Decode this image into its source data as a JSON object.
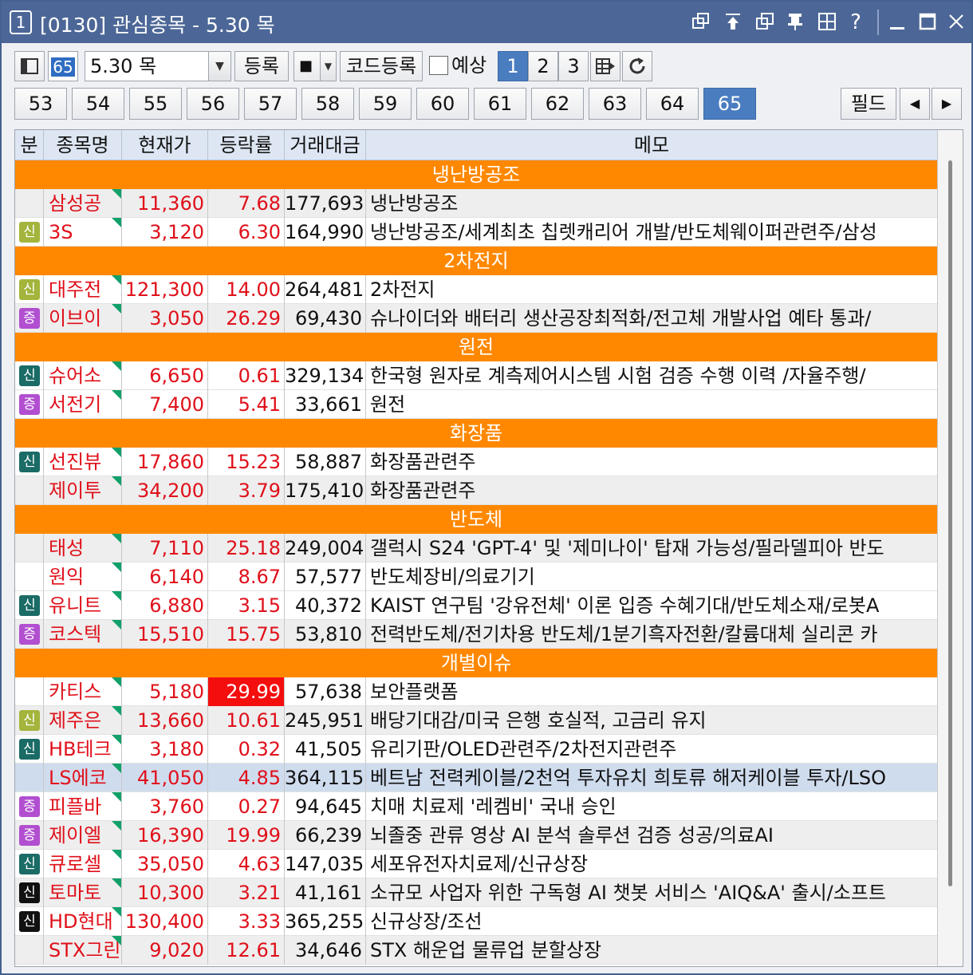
{
  "window": {
    "number": "1",
    "title": "[0130] 관심종목 - 5.30 목"
  },
  "titlebar_icons": [
    "restore-window-icon",
    "move-top-icon",
    "copy-window-icon",
    "pin-icon",
    "grid-layout-icon",
    "help-icon",
    "minimize-icon",
    "maximize-icon",
    "close-icon"
  ],
  "toolbar": {
    "group_num": "65",
    "group_combo": "5.30 목",
    "register_label": "등록",
    "square_label": "■",
    "code_register_label": "코드등록",
    "forecast_label": "예상",
    "pages": [
      "1",
      "2",
      "3"
    ],
    "active_page": "1"
  },
  "tabs": {
    "items": [
      "53",
      "54",
      "55",
      "56",
      "57",
      "58",
      "59",
      "60",
      "61",
      "62",
      "63",
      "64",
      "65"
    ],
    "active": "65",
    "field_label": "필드"
  },
  "grid": {
    "headers": {
      "badge": "분",
      "name": "종목명",
      "price": "현재가",
      "rate": "등락률",
      "volume": "거래대금",
      "memo": "메모"
    },
    "rows": [
      {
        "type": "section",
        "title": "냉난방공조"
      },
      {
        "type": "stock",
        "badge": "",
        "name": "삼성공",
        "price": "11,360",
        "rate": "7.68",
        "volume": "177,693",
        "memo": "냉난방공조",
        "bg": "gray"
      },
      {
        "type": "stock",
        "badge": "신",
        "badge_color": "yel",
        "name": "3S",
        "price": "3,120",
        "rate": "6.30",
        "volume": "164,990",
        "memo": "냉난방공조/세계최초 칩렛캐리어 개발/반도체웨이퍼관련주/삼성",
        "bg": "white"
      },
      {
        "type": "section",
        "title": "2차전지"
      },
      {
        "type": "stock",
        "badge": "신",
        "badge_color": "yel",
        "name": "대주전",
        "price": "121,300",
        "rate": "14.00",
        "volume": "264,481",
        "memo": "2차전지",
        "bg": "white"
      },
      {
        "type": "stock",
        "badge": "증",
        "badge_color": "pur",
        "name": "이브이",
        "price": "3,050",
        "rate": "26.29",
        "volume": "69,430",
        "memo": "슈나이더와 배터리 생산공장최적화/전고체 개발사업 예타 통과/",
        "bg": "gray"
      },
      {
        "type": "section",
        "title": "원전"
      },
      {
        "type": "stock",
        "badge": "신",
        "badge_color": "teal",
        "name": "슈어소",
        "price": "6,650",
        "rate": "0.61",
        "volume": "329,134",
        "memo": "한국형 원자로 계측제어시스템 시험 검증 수행 이력 /자율주행/",
        "bg": "white"
      },
      {
        "type": "stock",
        "badge": "증",
        "badge_color": "pur",
        "name": "서전기",
        "price": "7,400",
        "rate": "5.41",
        "volume": "33,661",
        "memo": "원전",
        "bg": "white"
      },
      {
        "type": "section",
        "title": "화장품"
      },
      {
        "type": "stock",
        "badge": "신",
        "badge_color": "teal",
        "name": "선진뷰",
        "price": "17,860",
        "rate": "15.23",
        "volume": "58,887",
        "memo": "화장품관련주",
        "bg": "white"
      },
      {
        "type": "stock",
        "badge": "",
        "name": "제이투",
        "price": "34,200",
        "rate": "3.79",
        "volume": "175,410",
        "memo": "화장품관련주",
        "bg": "gray"
      },
      {
        "type": "section",
        "title": "반도체"
      },
      {
        "type": "stock",
        "badge": "",
        "name": "태성",
        "price": "7,110",
        "rate": "25.18",
        "volume": "249,004",
        "memo": "갤럭시 S24 'GPT-4' 및 '제미나이' 탑재 가능성/필라델피아 반도",
        "bg": "gray"
      },
      {
        "type": "stock",
        "badge": "",
        "name": "원익",
        "price": "6,140",
        "rate": "8.67",
        "volume": "57,577",
        "memo": "반도체장비/의료기기",
        "bg": "white"
      },
      {
        "type": "stock",
        "badge": "신",
        "badge_color": "teal",
        "name": "유니트",
        "price": "6,880",
        "rate": "3.15",
        "volume": "40,372",
        "memo": "KAIST 연구팀 '강유전체' 이론 입증 수혜기대/반도체소재/로봇A",
        "bg": "white"
      },
      {
        "type": "stock",
        "badge": "증",
        "badge_color": "pur",
        "name": "코스텍",
        "price": "15,510",
        "rate": "15.75",
        "volume": "53,810",
        "memo": "전력반도체/전기차용 반도체/1분기흑자전환/칼륨대체 실리콘 카",
        "bg": "gray"
      },
      {
        "type": "section",
        "title": "개별이슈"
      },
      {
        "type": "stock",
        "badge": "",
        "name": "카티스",
        "price": "5,180",
        "rate": "29.99",
        "rate_highlight": true,
        "volume": "57,638",
        "memo": "보안플랫폼",
        "bg": "white"
      },
      {
        "type": "stock",
        "badge": "신",
        "badge_color": "yel",
        "name": "제주은",
        "price": "13,660",
        "rate": "10.61",
        "volume": "245,951",
        "memo": "배당기대감/미국 은행 호실적, 고금리 유지",
        "bg": "gray"
      },
      {
        "type": "stock",
        "badge": "신",
        "badge_color": "teal",
        "name": "HB테크",
        "price": "3,180",
        "rate": "0.32",
        "volume": "41,505",
        "memo": "유리기판/OLED관련주/2차전지관련주",
        "bg": "white"
      },
      {
        "type": "stock",
        "badge": "",
        "name": "LS에코",
        "price": "41,050",
        "rate": "4.85",
        "volume": "364,115",
        "memo": "베트남 전력케이블/2천억 투자유치 희토류 해저케이블 투자/LSO",
        "bg": "blue"
      },
      {
        "type": "stock",
        "badge": "증",
        "badge_color": "pur",
        "name": "피플바",
        "price": "3,760",
        "rate": "0.27",
        "volume": "94,645",
        "memo": "치매 치료제 '레켐비' 국내 승인",
        "bg": "white"
      },
      {
        "type": "stock",
        "badge": "증",
        "badge_color": "pur",
        "name": "제이엘",
        "price": "16,390",
        "rate": "19.99",
        "volume": "66,239",
        "memo": "뇌졸중 관류 영상 AI 분석 솔루션 검증 성공/의료AI",
        "bg": "gray"
      },
      {
        "type": "stock",
        "badge": "신",
        "badge_color": "teal",
        "name": "큐로셀",
        "price": "35,050",
        "rate": "4.63",
        "volume": "147,035",
        "memo": "세포유전자치료제/신규상장",
        "bg": "white"
      },
      {
        "type": "stock",
        "badge": "신",
        "badge_color": "blk",
        "name": "토마토",
        "price": "10,300",
        "rate": "3.21",
        "volume": "41,161",
        "memo": "소규모 사업자 위한 구독형 AI 챗봇 서비스 'AIQ&A' 출시/소프트",
        "bg": "gray"
      },
      {
        "type": "stock",
        "badge": "신",
        "badge_color": "blk",
        "name": "HD현대",
        "price": "130,400",
        "rate": "3.33",
        "volume": "365,255",
        "memo": "신규상장/조선",
        "bg": "white"
      },
      {
        "type": "stock",
        "badge": "",
        "name": "STX그린",
        "price": "9,020",
        "rate": "12.61",
        "volume": "34,646",
        "memo": "STX 해운업 물류업 분할상장",
        "bg": "gray"
      }
    ]
  }
}
